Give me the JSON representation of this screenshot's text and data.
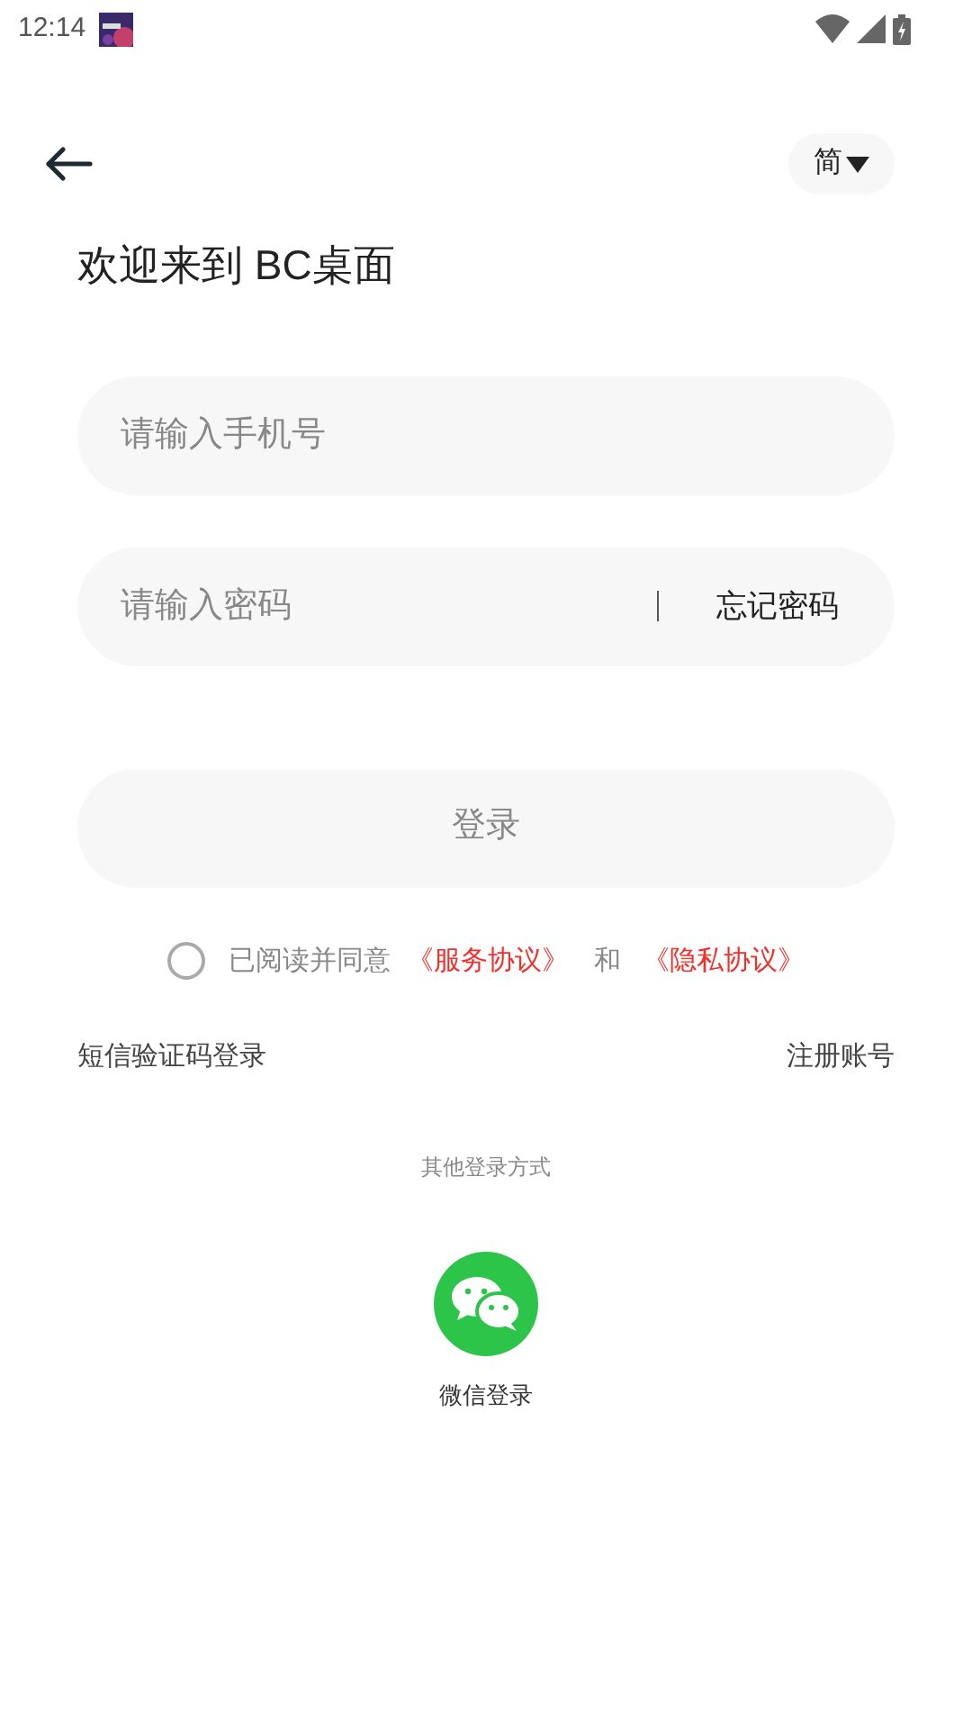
{
  "status_bar": {
    "time": "12:14"
  },
  "header": {
    "language": "简"
  },
  "title": "欢迎来到 BC桌面",
  "phone_field": {
    "placeholder": "请输入手机号"
  },
  "password_field": {
    "placeholder": "请输入密码",
    "forgot": "忘记密码"
  },
  "login_button": {
    "label": "登录",
    "disabled": true
  },
  "agreement": {
    "checked": false,
    "text": "已阅读并同意",
    "service_link": "《服务协议》",
    "and": "和",
    "privacy_link": "《隐私协议》"
  },
  "links": {
    "sms_login": "短信验证码登录",
    "register": "注册账号"
  },
  "other_login": {
    "heading": "其他登录方式",
    "wechat_label": "微信登录"
  }
}
